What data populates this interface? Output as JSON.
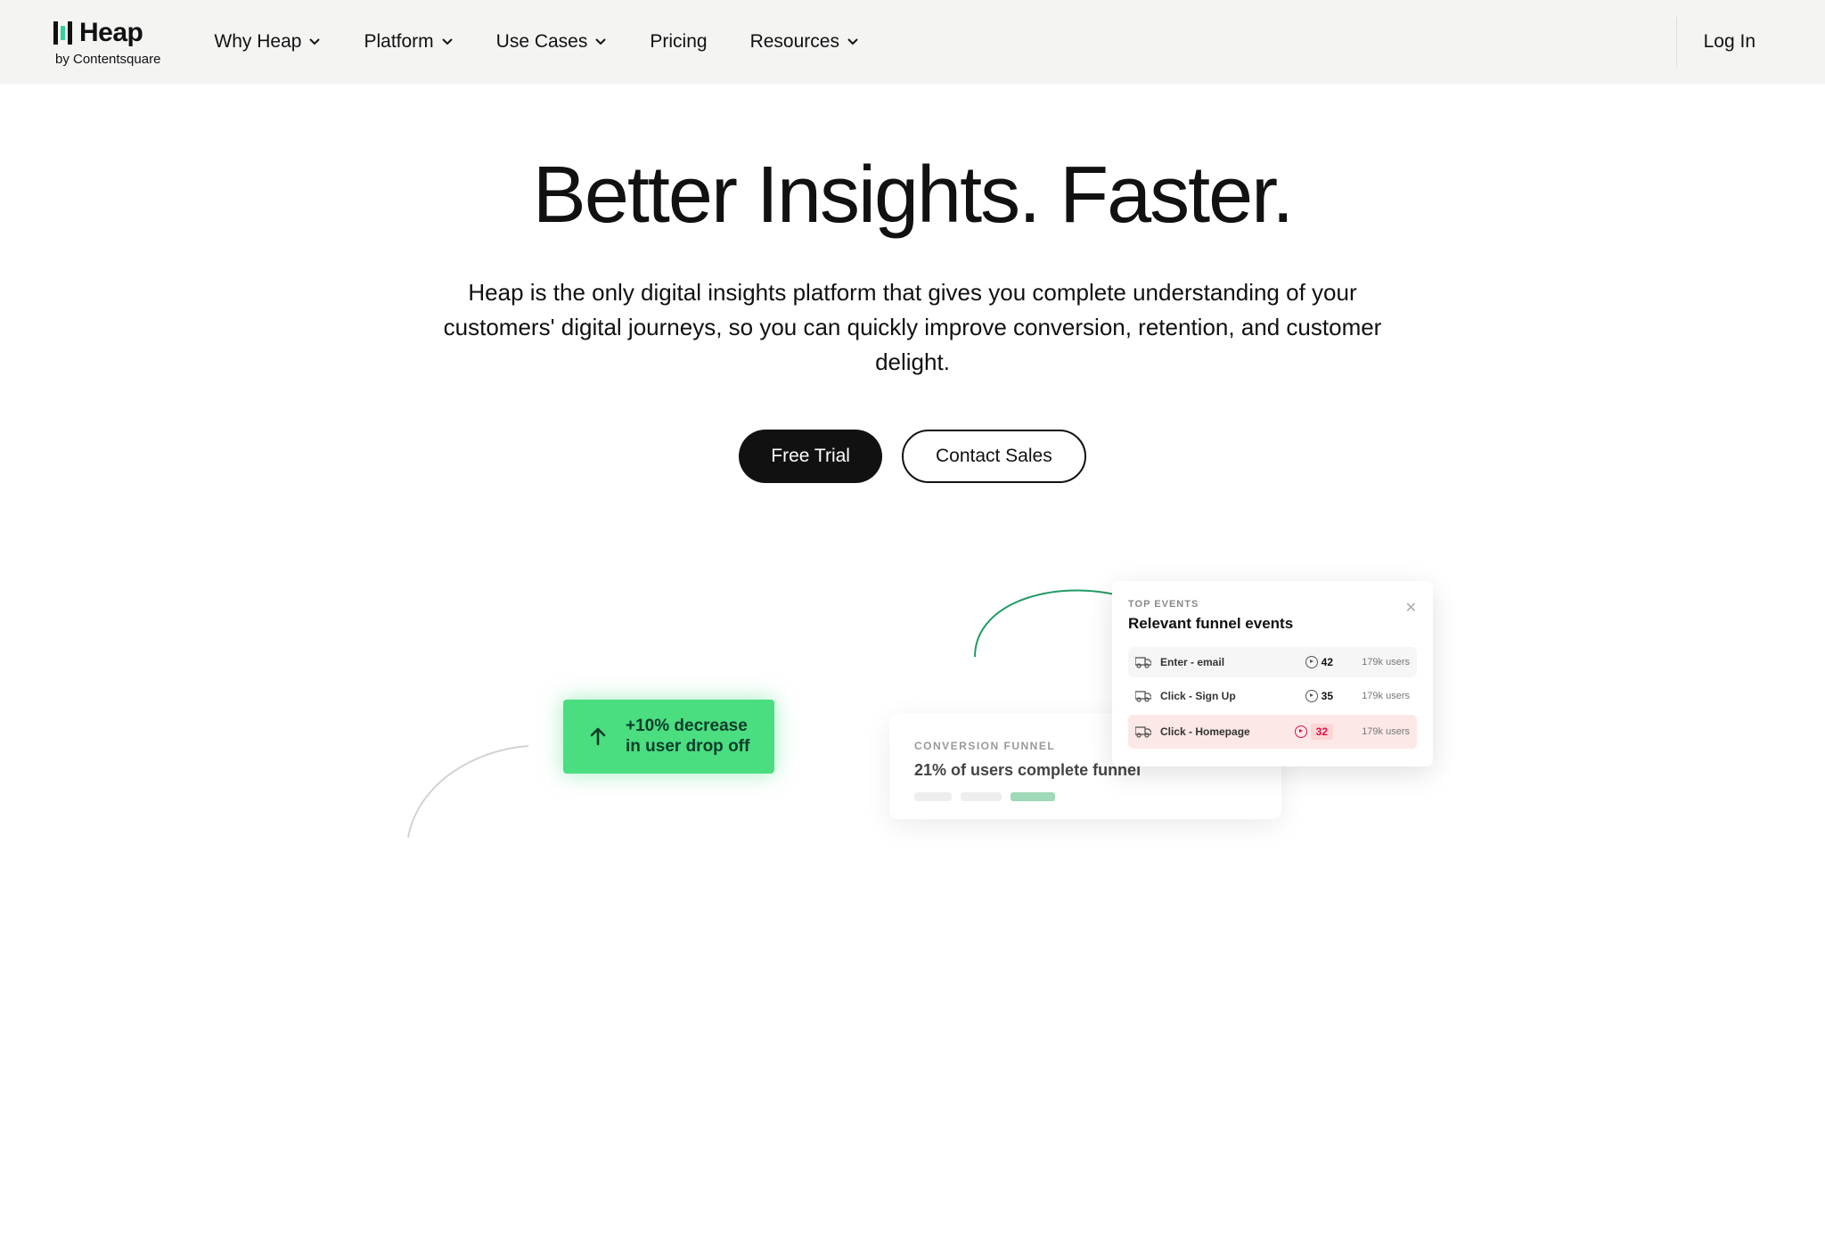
{
  "header": {
    "logo_name": "Heap",
    "logo_byline": "by Contentsquare",
    "nav": [
      {
        "label": "Why Heap",
        "hasDropdown": true
      },
      {
        "label": "Platform",
        "hasDropdown": true
      },
      {
        "label": "Use Cases",
        "hasDropdown": true
      },
      {
        "label": "Pricing",
        "hasDropdown": false
      },
      {
        "label": "Resources",
        "hasDropdown": true
      }
    ],
    "login": "Log In"
  },
  "hero": {
    "title": "Better Insights. Faster.",
    "subtitle": "Heap is the only digital insights platform that gives you complete understanding of your customers' digital journeys, so you can quickly improve conversion, retention, and customer delight.",
    "cta_primary": "Free Trial",
    "cta_secondary": "Contact Sales"
  },
  "badge": {
    "line1": "+10% decrease",
    "line2": "in user drop off"
  },
  "events": {
    "label": "TOP EVENTS",
    "title": "Relevant funnel events",
    "rows": [
      {
        "name": "Enter - email",
        "count": "42",
        "users": "179k users",
        "highlight": "gray"
      },
      {
        "name": "Click - Sign Up",
        "count": "35",
        "users": "179k users",
        "highlight": "none"
      },
      {
        "name": "Click - Homepage",
        "count": "32",
        "users": "179k users",
        "highlight": "red"
      }
    ]
  },
  "funnel": {
    "label": "CONVERSION FUNNEL",
    "title": "21% of users complete funnel"
  }
}
